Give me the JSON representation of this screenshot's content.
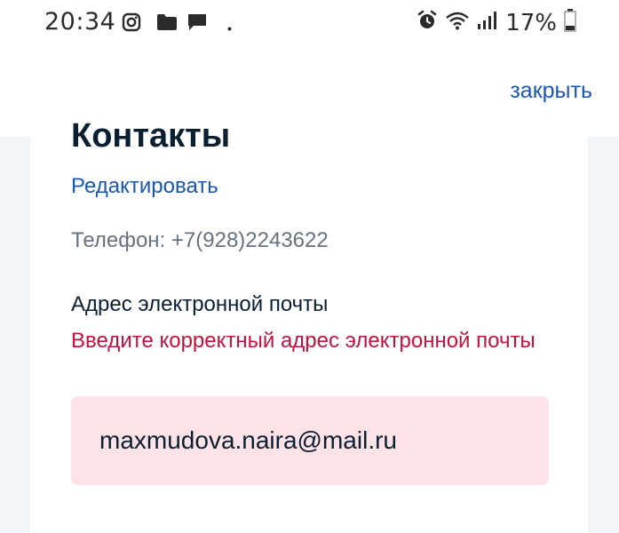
{
  "status_bar": {
    "time": "20:34",
    "battery": "17%",
    "left_icons": [
      "instagram-icon",
      "folder-icon",
      "message-icon",
      "dot-icon"
    ],
    "right_icons": [
      "alarm-icon",
      "wifi-icon",
      "signal-icon",
      "battery-icon"
    ]
  },
  "header": {
    "close_label": "закрыть"
  },
  "contacts": {
    "title": "Контакты",
    "edit_label": "Редактировать",
    "phone": "Телефон: +7(928)2243622",
    "email_label": "Адрес электронной почты",
    "email_error": "Введите корректный адрес электронной почты",
    "email_value": "maxmudova.naira@mail.ru"
  },
  "colors": {
    "link": "#1a57b0",
    "error": "#c4113d",
    "input_error_bg": "#fde2e6",
    "page_bg": "#f1f4f9"
  }
}
